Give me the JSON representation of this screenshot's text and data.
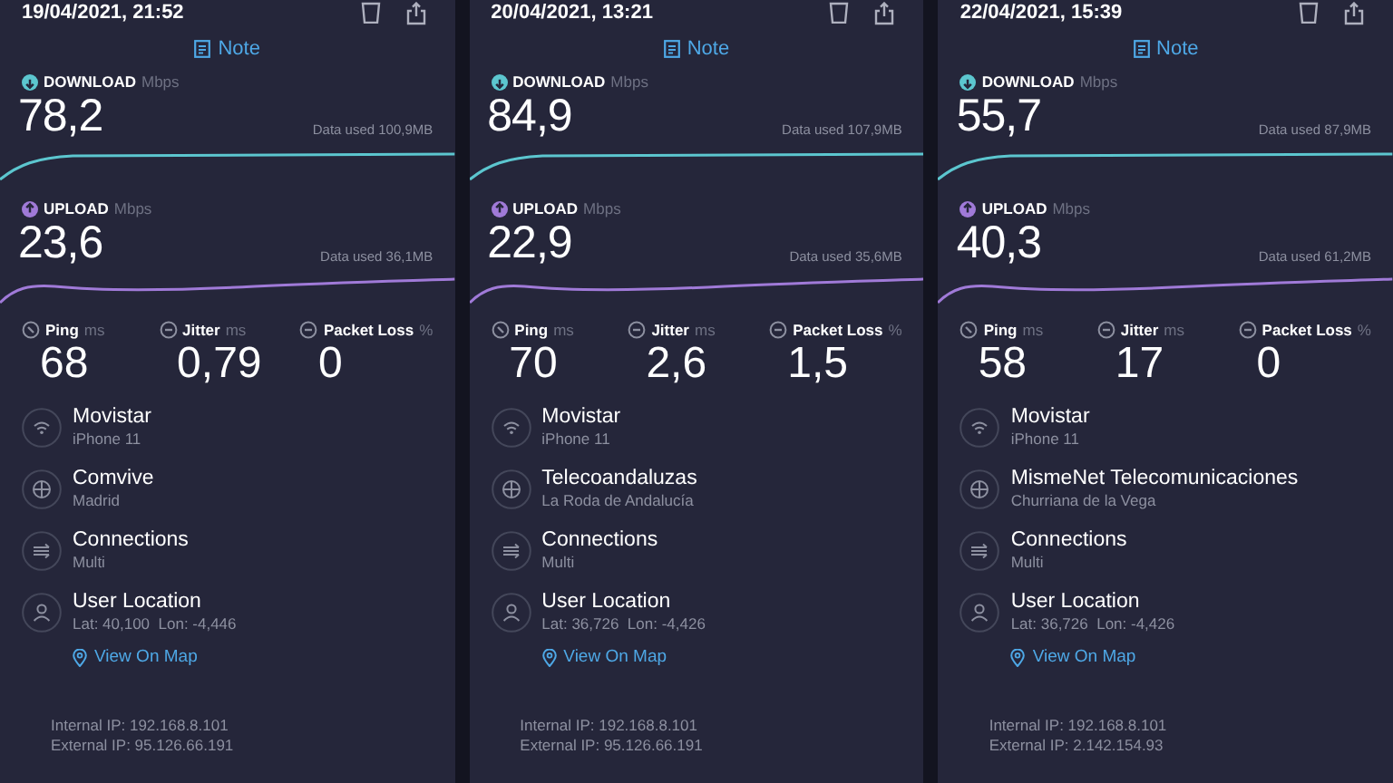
{
  "panels": [
    {
      "timestamp": "19/04/2021, 21:52",
      "note": "Note",
      "speeds": [
        {
          "kind": "download",
          "label": "DOWNLOAD",
          "unit": "Mbps",
          "value": "78,2",
          "data_used": "Data used 100,9MB"
        },
        {
          "kind": "upload",
          "label": "UPLOAD",
          "unit": "Mbps",
          "value": "23,6",
          "data_used": "Data used 36,1MB"
        }
      ],
      "metrics": [
        {
          "kind": "ping",
          "label": "Ping",
          "unit": "ms",
          "value": "68"
        },
        {
          "kind": "jitter",
          "label": "Jitter",
          "unit": "ms",
          "value": "0,79"
        },
        {
          "kind": "loss",
          "label": "Packet Loss",
          "unit": "%",
          "value": "0"
        }
      ],
      "details": [
        {
          "kind": "wifi",
          "title": "Movistar",
          "subtitle": "iPhone 11"
        },
        {
          "kind": "server",
          "title": "Comvive",
          "subtitle": "Madrid"
        },
        {
          "kind": "connections",
          "title": "Connections",
          "subtitle": "Multi"
        },
        {
          "kind": "location",
          "title": "User Location",
          "subtitle": "Lat: 40,100  Lon: -4,446"
        }
      ],
      "map_link": "View On Map",
      "internal_ip": "Internal IP: 192.168.8.101",
      "external_ip": "External IP: 95.126.66.191"
    },
    {
      "timestamp": "20/04/2021, 13:21",
      "note": "Note",
      "speeds": [
        {
          "kind": "download",
          "label": "DOWNLOAD",
          "unit": "Mbps",
          "value": "84,9",
          "data_used": "Data used 107,9MB"
        },
        {
          "kind": "upload",
          "label": "UPLOAD",
          "unit": "Mbps",
          "value": "22,9",
          "data_used": "Data used 35,6MB"
        }
      ],
      "metrics": [
        {
          "kind": "ping",
          "label": "Ping",
          "unit": "ms",
          "value": "70"
        },
        {
          "kind": "jitter",
          "label": "Jitter",
          "unit": "ms",
          "value": "2,6"
        },
        {
          "kind": "loss",
          "label": "Packet Loss",
          "unit": "%",
          "value": "1,5"
        }
      ],
      "details": [
        {
          "kind": "wifi",
          "title": "Movistar",
          "subtitle": "iPhone 11"
        },
        {
          "kind": "server",
          "title": "Telecoandaluzas",
          "subtitle": "La Roda de Andalucía"
        },
        {
          "kind": "connections",
          "title": "Connections",
          "subtitle": "Multi"
        },
        {
          "kind": "location",
          "title": "User Location",
          "subtitle": "Lat: 36,726  Lon: -4,426"
        }
      ],
      "map_link": "View On Map",
      "internal_ip": "Internal IP: 192.168.8.101",
      "external_ip": "External IP: 95.126.66.191"
    },
    {
      "timestamp": "22/04/2021, 15:39",
      "note": "Note",
      "speeds": [
        {
          "kind": "download",
          "label": "DOWNLOAD",
          "unit": "Mbps",
          "value": "55,7",
          "data_used": "Data used 87,9MB"
        },
        {
          "kind": "upload",
          "label": "UPLOAD",
          "unit": "Mbps",
          "value": "40,3",
          "data_used": "Data used 61,2MB"
        }
      ],
      "metrics": [
        {
          "kind": "ping",
          "label": "Ping",
          "unit": "ms",
          "value": "58"
        },
        {
          "kind": "jitter",
          "label": "Jitter",
          "unit": "ms",
          "value": "17"
        },
        {
          "kind": "loss",
          "label": "Packet Loss",
          "unit": "%",
          "value": "0"
        }
      ],
      "details": [
        {
          "kind": "wifi",
          "title": "Movistar",
          "subtitle": "iPhone 11"
        },
        {
          "kind": "server",
          "title": "MismeNet Telecomunicaciones",
          "subtitle": "Churriana de la Vega"
        },
        {
          "kind": "connections",
          "title": "Connections",
          "subtitle": "Multi"
        },
        {
          "kind": "location",
          "title": "User Location",
          "subtitle": "Lat: 36,726  Lon: -4,426"
        }
      ],
      "map_link": "View On Map",
      "internal_ip": "Internal IP: 192.168.8.101",
      "external_ip": "External IP: 2.142.154.93"
    }
  ]
}
